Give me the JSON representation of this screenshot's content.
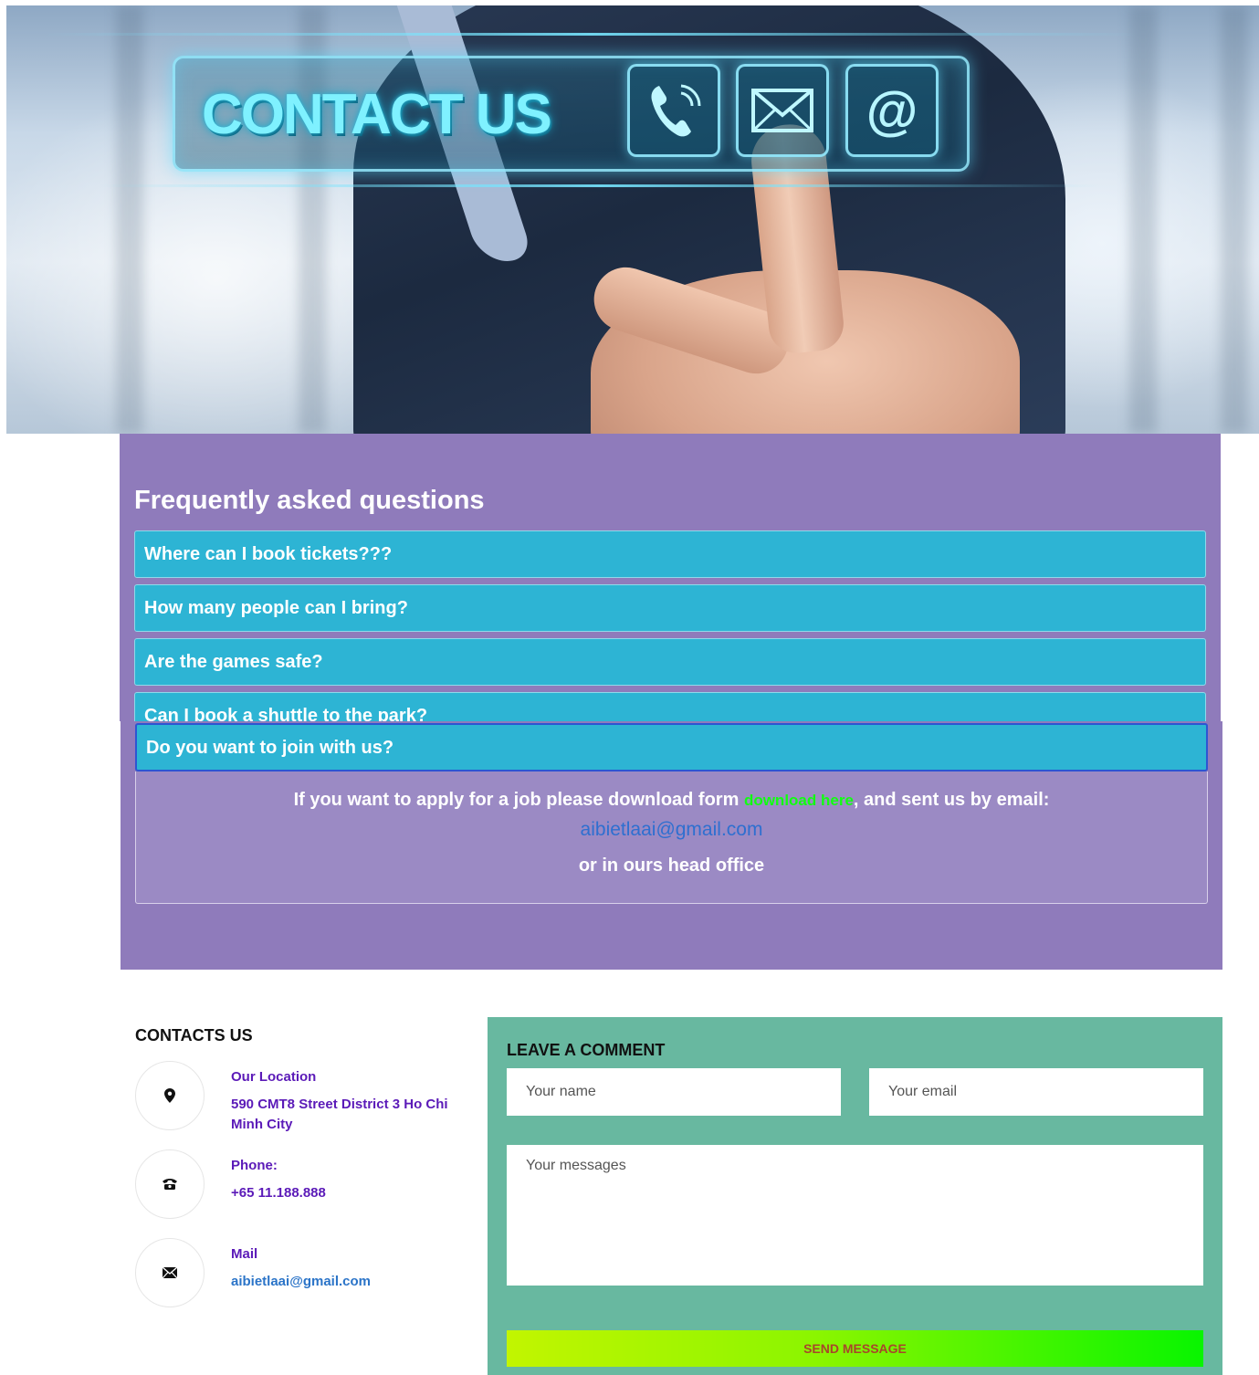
{
  "hero": {
    "title": "CONTACT US",
    "icons": [
      "phone-icon",
      "envelope-icon",
      "at-sign-icon"
    ]
  },
  "faq": {
    "title": "Frequently asked questions",
    "questions": [
      "Where can I book tickets???",
      "How many people can I bring?",
      "Are the games safe?",
      "Can I book a shuttle to the park?"
    ],
    "open_question": "Do you want to join with us?",
    "answer": {
      "text_before": "If you want to apply for a job please download form ",
      "link": "download here",
      "text_after": ", and sent us by email:",
      "email": "aibietlaai@gmail.com",
      "line3": "or in ours head office"
    }
  },
  "contacts": {
    "title": "CONTACTS US",
    "location_label": "Our Location",
    "location_value": "590 CMT8 Street District 3 Ho Chi Minh City",
    "phone_label": "Phone:",
    "phone_value": "+65 11.188.888",
    "mail_label": "Mail",
    "mail_value": "aibietlaai@gmail.com"
  },
  "comment_form": {
    "title": "LEAVE A COMMENT",
    "name_placeholder": "Your name",
    "email_placeholder": "Your email",
    "message_placeholder": "Your messages",
    "send_label": "SEND MESSAGE"
  },
  "colors": {
    "faq_bg": "#8f7bbb",
    "question_bg": "#2db4d4",
    "form_bg": "#68b8a0",
    "contact_text": "#5b1ab8",
    "link_green": "#11ff11"
  }
}
